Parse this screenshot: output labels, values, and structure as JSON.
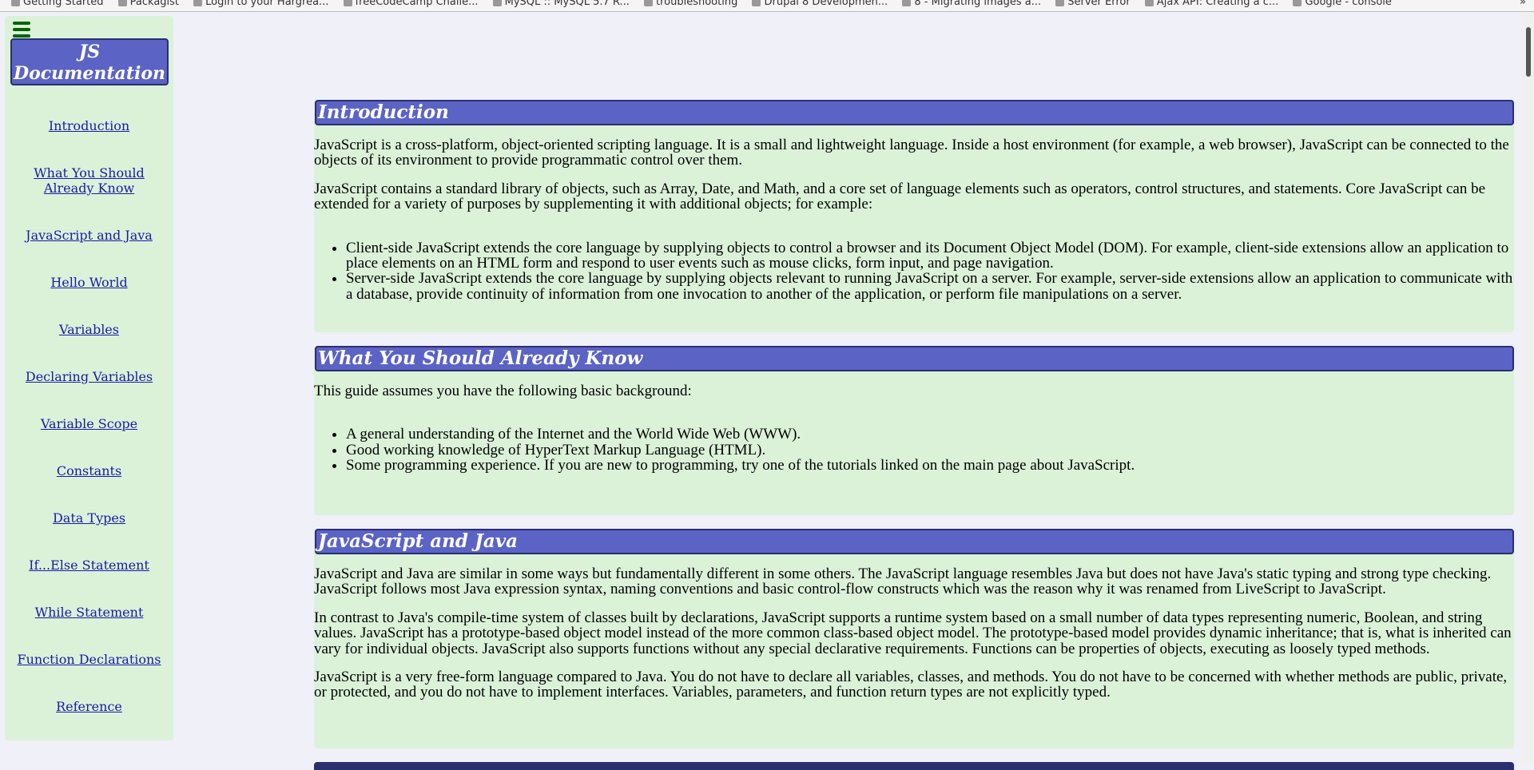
{
  "bookmarks": [
    "Getting Started",
    "Packagist",
    "Login to your Hargrea...",
    "freeCodeCamp Challe...",
    "MySQL :: MySQL 5.7 R...",
    "troubleshooting",
    "Drupal 8 Developmen...",
    "8 - Migrating images a...",
    "Server Error",
    "Ajax API: Creating a c...",
    "Google - console"
  ],
  "bookmarks_more": "»",
  "sidebar": {
    "title_line1": "JS",
    "title_line2": "Documentation",
    "items": [
      "Introduction",
      "What You Should Already Know",
      "JavaScript and Java",
      "Hello World",
      "Variables",
      "Declaring Variables",
      "Variable Scope",
      "Constants",
      "Data Types",
      "If...Else Statement",
      "While Statement",
      "Function Declarations",
      "Reference"
    ]
  },
  "sections": [
    {
      "title": "Introduction",
      "paragraphs": [
        "JavaScript is a cross-platform, object-oriented scripting language. It is a small and lightweight language. Inside a host environment (for example, a web browser), JavaScript can be connected to the objects of its environment to provide programmatic control over them.",
        "JavaScript contains a standard library of objects, such as Array, Date, and Math, and a core set of language elements such as operators, control structures, and statements. Core JavaScript can be extended for a variety of purposes by supplementing it with additional objects; for example:"
      ],
      "list": [
        "Client-side JavaScript extends the core language by supplying objects to control a browser and its Document Object Model (DOM). For example, client-side extensions allow an application to place elements on an HTML form and respond to user events such as mouse clicks, form input, and page navigation.",
        "Server-side JavaScript extends the core language by supplying objects relevant to running JavaScript on a server. For example, server-side extensions allow an application to communicate with a database, provide continuity of information from one invocation to another of the application, or perform file manipulations on a server."
      ]
    },
    {
      "title": "What You Should Already Know",
      "paragraphs": [
        "This guide assumes you have the following basic background:"
      ],
      "list": [
        "A general understanding of the Internet and the World Wide Web (WWW).",
        "Good working knowledge of HyperText Markup Language (HTML).",
        "Some programming experience. If you are new to programming, try one of the tutorials linked on the main page about JavaScript."
      ]
    },
    {
      "title": "JavaScript and Java",
      "paragraphs": [
        "JavaScript and Java are similar in some ways but fundamentally different in some others. The JavaScript language resembles Java but does not have Java's static typing and strong type checking. JavaScript follows most Java expression syntax, naming conventions and basic control-flow constructs which was the reason why it was renamed from LiveScript to JavaScript.",
        "In contrast to Java's compile-time system of classes built by declarations, JavaScript supports a runtime system based on a small number of data types representing numeric, Boolean, and string values. JavaScript has a prototype-based object model instead of the more common class-based object model. The prototype-based model provides dynamic inheritance; that is, what is inherited can vary for individual objects. JavaScript also supports functions without any special declarative requirements. Functions can be properties of objects, executing as loosely typed methods.",
        "JavaScript is a very free-form language compared to Java. You do not have to declare all variables, classes, and methods. You do not have to be concerned with whether methods are public, private, or protected, and you do not have to implement interfaces. Variables, parameters, and function return types are not explicitly typed."
      ]
    }
  ],
  "colors": {
    "header_bg": "#5b63c5",
    "section_bg": "#dbf2d9",
    "link": "#1a1aa6",
    "menu_icon": "#006400",
    "page_bg": "#f0f0f8"
  }
}
